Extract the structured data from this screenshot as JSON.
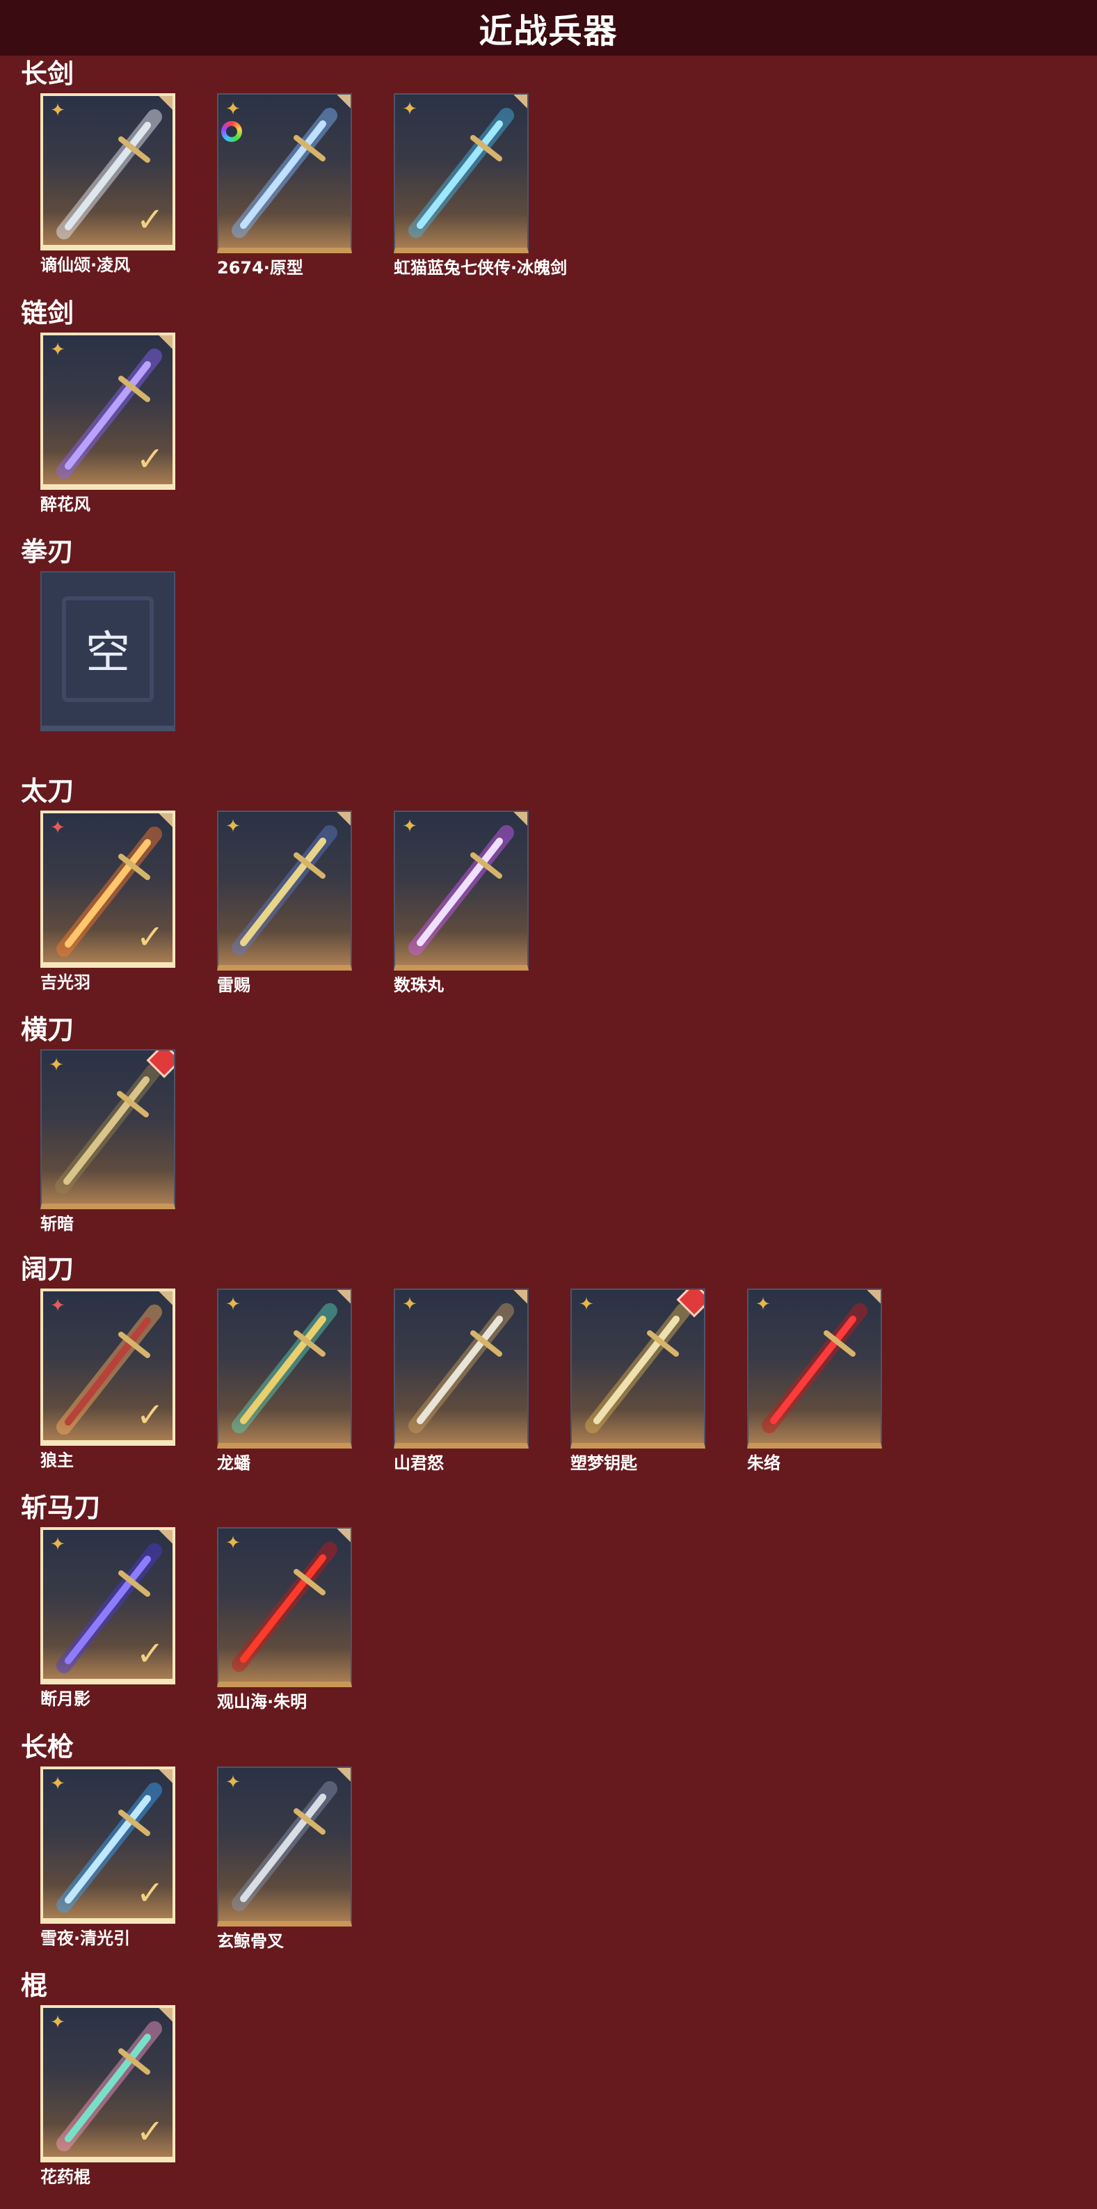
{
  "page_title": "近战兵器",
  "colors": {
    "background": "#661a1e",
    "title_bar": "#3a0b10",
    "selected_border": "#f6e6bc",
    "accent_gold": "#e7b64a"
  },
  "sections": [
    {
      "title": "长剑",
      "items": [
        {
          "name": "谪仙颂·凌风",
          "selected": true,
          "rarity": "gold",
          "blade": "#dfe7ee",
          "glow": "#f0f4ff"
        },
        {
          "name": "2674·原型",
          "selected": false,
          "rarity": "gold",
          "ring": true,
          "blade": "#bfe0ff",
          "glow": "#7fb8ff"
        },
        {
          "name": "虹猫蓝兔七侠传·冰魄剑",
          "selected": false,
          "rarity": "gold",
          "blade": "#9ee8ff",
          "glow": "#45b8e8"
        }
      ]
    },
    {
      "title": "链剑",
      "items": [
        {
          "name": "醉花风",
          "selected": true,
          "rarity": "gold",
          "blade": "#b9a2ff",
          "glow": "#8a63ff"
        }
      ]
    },
    {
      "title": "拳刃",
      "items": [
        {
          "name": "",
          "empty": true,
          "empty_text": "空"
        }
      ]
    },
    {
      "title": "太刀",
      "items": [
        {
          "name": "吉光羽",
          "selected": true,
          "rarity": "red",
          "blade": "#ffc66b",
          "glow": "#ff7a2a"
        },
        {
          "name": "雷赐",
          "selected": false,
          "rarity": "gold",
          "blade": "#e8d58a",
          "glow": "#5e7ac8"
        },
        {
          "name": "数珠丸",
          "selected": false,
          "rarity": "gold",
          "blade": "#efe0ff",
          "glow": "#d25cff"
        }
      ]
    },
    {
      "title": "横刀",
      "items": [
        {
          "name": "斩暗",
          "selected": false,
          "rarity": "gold",
          "redcorner": true,
          "blade": "#d9c48a",
          "glow": "#9a8650"
        }
      ]
    },
    {
      "title": "阔刀",
      "items": [
        {
          "name": "狼主",
          "selected": true,
          "rarity": "red",
          "blade": "#b8423a",
          "glow": "#ffb060"
        },
        {
          "name": "龙蟠",
          "selected": false,
          "rarity": "gold",
          "blade": "#e9cf6e",
          "glow": "#58d6b8"
        },
        {
          "name": "山君怒",
          "selected": false,
          "rarity": "gold",
          "blade": "#e8e4d8",
          "glow": "#c9a060"
        },
        {
          "name": "塑梦钥匙",
          "selected": false,
          "rarity": "gold",
          "redcorner": true,
          "blade": "#efe0b0",
          "glow": "#d8b050"
        },
        {
          "name": "朱络",
          "selected": false,
          "rarity": "gold",
          "blade": "#ff3a3a",
          "glow": "#c81818"
        }
      ]
    },
    {
      "title": "斩马刀",
      "items": [
        {
          "name": "断月影",
          "selected": true,
          "rarity": "gold",
          "blade": "#8e7cff",
          "glow": "#4b3ad8"
        },
        {
          "name": "观山海·朱明",
          "selected": false,
          "rarity": "gold",
          "blade": "#ff3a2a",
          "glow": "#c81818"
        }
      ]
    },
    {
      "title": "长枪",
      "items": [
        {
          "name": "雪夜·清光引",
          "selected": true,
          "rarity": "gold",
          "blade": "#bfe8ff",
          "glow": "#3aa8ff"
        },
        {
          "name": "玄鲸骨叉",
          "selected": false,
          "rarity": "gold",
          "blade": "#d8dde6",
          "glow": "#8a96b0"
        }
      ]
    },
    {
      "title": "棍",
      "items": [
        {
          "name": "花药棍",
          "selected": true,
          "rarity": "gold",
          "blade": "#79e0c8",
          "glow": "#ff9ac8"
        }
      ]
    }
  ]
}
